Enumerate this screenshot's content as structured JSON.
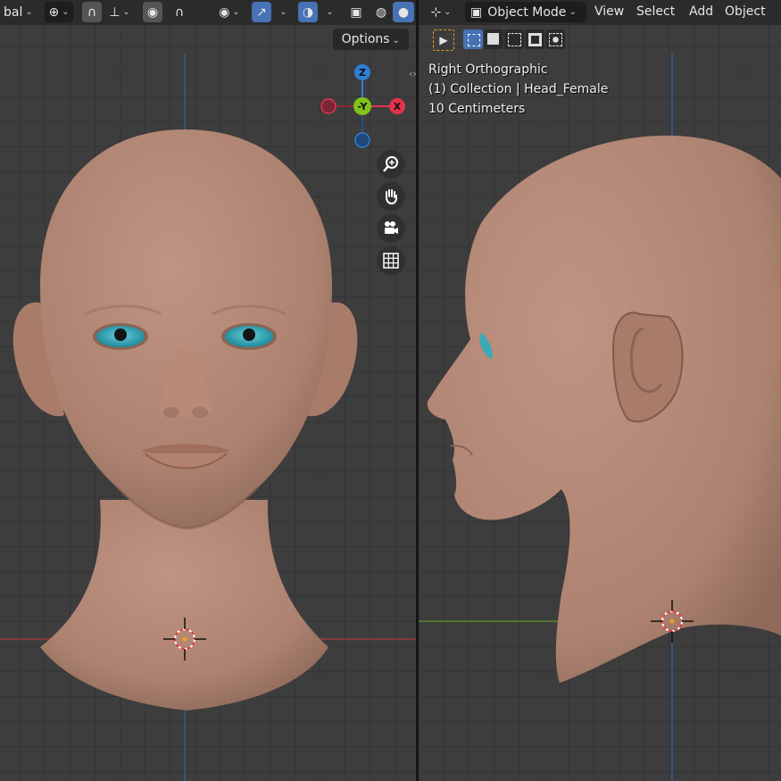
{
  "header_left": {
    "transform_pivot_label": "bal",
    "options_label": "Options"
  },
  "header_right": {
    "mode_label": "Object Mode",
    "menus": [
      "View",
      "Select",
      "Add",
      "Object"
    ]
  },
  "viewport_right_overlay": {
    "view_name": "Right Orthographic",
    "collection_line": "(1) Collection | Head_Female",
    "scale_line": "10 Centimeters"
  },
  "gizmo": {
    "axes": {
      "z": "Z",
      "y": "-Y",
      "x": "X"
    },
    "colors": {
      "x": "#e5334d",
      "y": "#80c21a",
      "z": "#2f7fd6"
    }
  },
  "navigation_icons": [
    "zoom-icon",
    "pan-hand-icon",
    "camera-icon",
    "grid-icon"
  ],
  "colors": {
    "viewport_bg": "#3d3d3d",
    "grid_line": "#353535",
    "header_bg": "#2b2b2b",
    "accent_blue": "#4772b3",
    "skin": "#b38672",
    "iris": "#3aa8b8",
    "x_axis_line": "#a03a3a",
    "y_axis_line": "#5d8a2e",
    "z_axis_line": "#2f5f9a"
  }
}
